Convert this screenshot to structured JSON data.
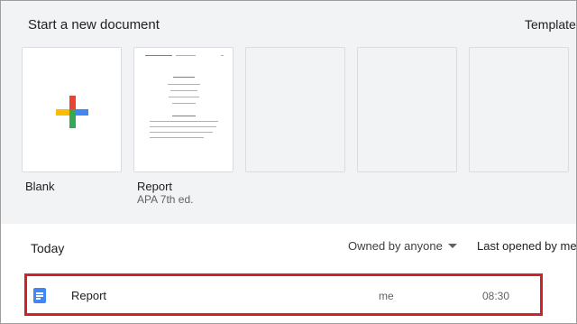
{
  "header": {
    "title": "Start a new document",
    "gallery_link": "Template g"
  },
  "templates": [
    {
      "label": "Blank",
      "subtitle": ""
    },
    {
      "label": "Report",
      "subtitle": "APA 7th ed."
    }
  ],
  "recent": {
    "section_title": "Today",
    "owner_filter": "Owned by anyone",
    "sort_label": "Last opened by me",
    "files": [
      {
        "name": "Report",
        "owner": "me",
        "time": "08:30",
        "icon": "docs-file-icon",
        "highlighted": true
      }
    ]
  },
  "colors": {
    "template_bg": "#f1f3f4",
    "highlight_border": "#d0202a",
    "docs_blue": "#4285f4"
  }
}
